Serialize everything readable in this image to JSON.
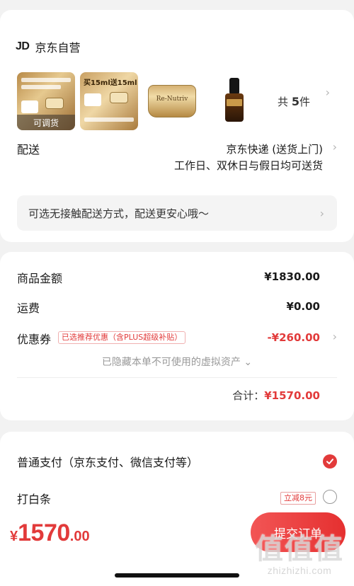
{
  "shop": {
    "logo": "JD",
    "name": "京东自营"
  },
  "items": {
    "thumbnails": [
      {
        "badge": "可调货",
        "label": "",
        "icon": "product-gift-set"
      },
      {
        "label": "买15ml送15ml",
        "icon": "product-promo-set"
      },
      {
        "label": "Re-Nutriv",
        "icon": "cream-jar"
      },
      {
        "label": "",
        "icon": "serum-bottle"
      }
    ],
    "count_prefix": "共",
    "count_value": "5",
    "count_suffix": "件"
  },
  "delivery": {
    "label": "配送",
    "method": "京东快递 (送货上门)",
    "schedule": "工作日、双休日与假日均可送货",
    "contactless_notice": "可选无接触配送方式，配送更安心哦～"
  },
  "amounts": {
    "subtotal_label": "商品金额",
    "subtotal_value": "¥1830.00",
    "shipping_label": "运费",
    "shipping_value": "¥0.00",
    "coupon_label": "优惠券",
    "coupon_tag": "已选推荐优惠（含PLUS超级补贴）",
    "coupon_value": "-¥260.00",
    "hidden_note": "已隐藏本单不可使用的虚拟资产",
    "total_label": "合计：",
    "total_value": "¥1570.00"
  },
  "payment": {
    "options": [
      {
        "label": "普通支付（京东支付、微信支付等）",
        "selected": true
      },
      {
        "label": "打白条",
        "tag": "立减8元",
        "selected": false
      }
    ]
  },
  "footer": {
    "currency": "¥",
    "amount_int": "1570",
    "amount_dec": ".00",
    "submit_label": "提交订单"
  },
  "watermark": {
    "glyphs": "值值值",
    "domain": "zhizhizhi.com"
  },
  "colors": {
    "accent": "#e23a3a",
    "background": "#f2f2f2",
    "card": "#ffffff"
  }
}
